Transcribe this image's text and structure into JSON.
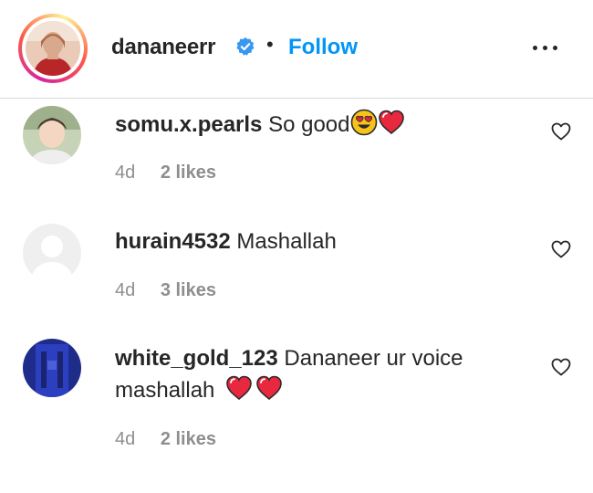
{
  "header": {
    "username": "dananeerr",
    "separator": "•",
    "follow_label": "Follow",
    "verified": true,
    "more_icon": "more-horizontal-icon"
  },
  "comments": [
    {
      "username": "somu.x.pearls",
      "text": "So good",
      "emojis": [
        "heart-eyes-emoji",
        "heart-emoji"
      ],
      "time": "4d",
      "likes": "2 likes"
    },
    {
      "username": "hurain4532",
      "text": "Mashallah",
      "emojis": [],
      "time": "4d",
      "likes": "3 likes"
    },
    {
      "username": "white_gold_123",
      "text": "Dananeer ur voice mashallah",
      "emojis": [
        "heart-emoji",
        "heart-emoji"
      ],
      "time": "4d",
      "likes": "2 likes"
    }
  ],
  "colors": {
    "accent": "#0095f6",
    "text": "#262626",
    "muted": "#8e8e8e",
    "heart": "#ed4956",
    "divider": "#dbdbdb"
  }
}
